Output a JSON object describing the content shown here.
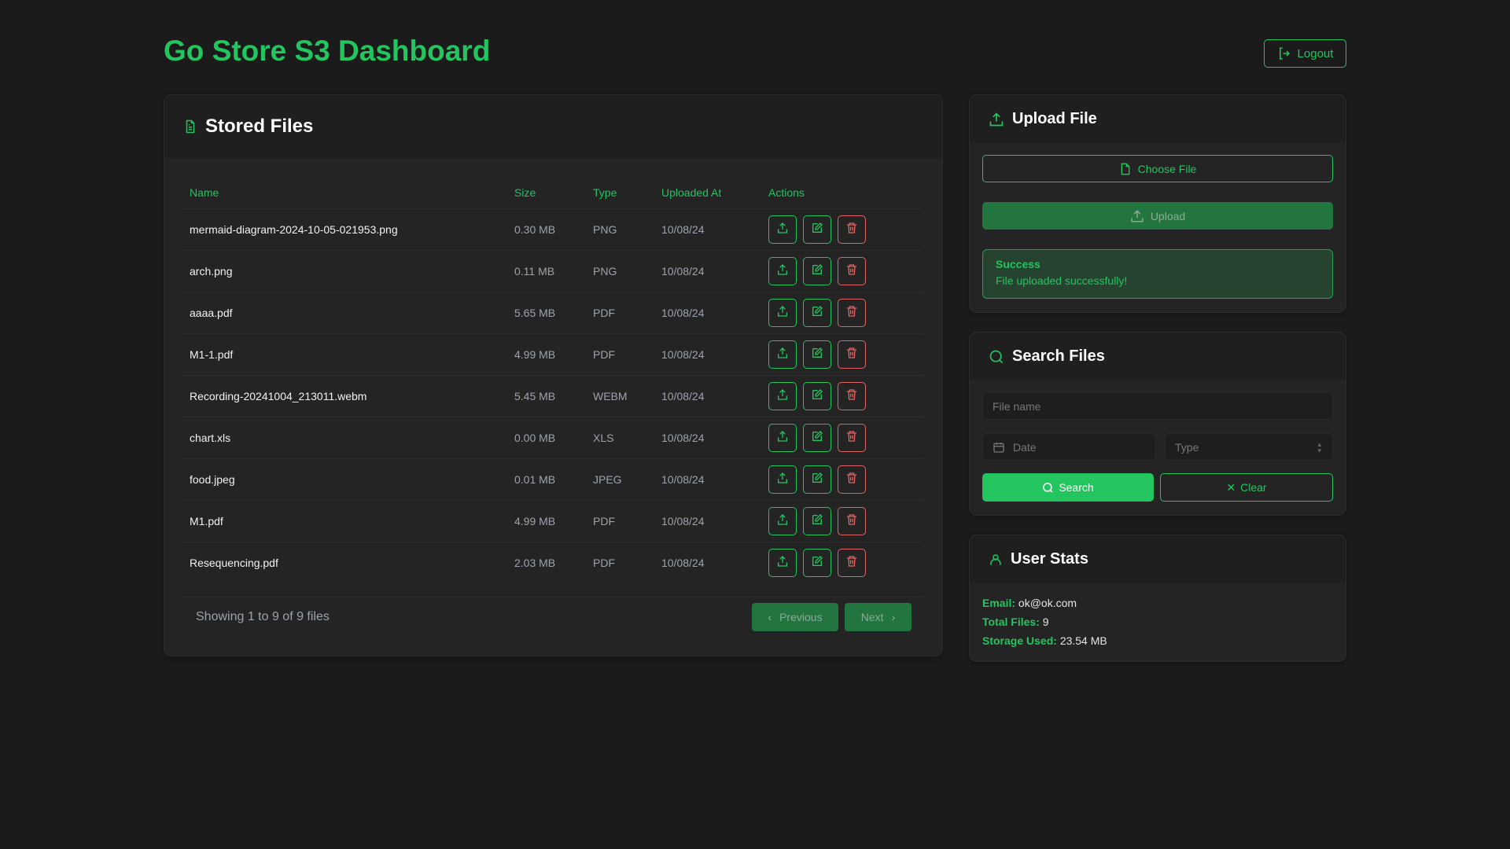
{
  "header": {
    "title": "Go Store S3 Dashboard",
    "logout": "Logout"
  },
  "files": {
    "title": "Stored Files",
    "columns": [
      "Name",
      "Size",
      "Type",
      "Uploaded At",
      "Actions"
    ],
    "rows": [
      {
        "name": "mermaid-diagram-2024-10-05-021953.png",
        "size": "0.30 MB",
        "type": "PNG",
        "uploaded": "10/08/24"
      },
      {
        "name": "arch.png",
        "size": "0.11 MB",
        "type": "PNG",
        "uploaded": "10/08/24"
      },
      {
        "name": "aaaa.pdf",
        "size": "5.65 MB",
        "type": "PDF",
        "uploaded": "10/08/24"
      },
      {
        "name": "M1-1.pdf",
        "size": "4.99 MB",
        "type": "PDF",
        "uploaded": "10/08/24"
      },
      {
        "name": "Recording-20241004_213011.webm",
        "size": "5.45 MB",
        "type": "WEBM",
        "uploaded": "10/08/24"
      },
      {
        "name": "chart.xls",
        "size": "0.00 MB",
        "type": "XLS",
        "uploaded": "10/08/24"
      },
      {
        "name": "food.jpeg",
        "size": "0.01 MB",
        "type": "JPEG",
        "uploaded": "10/08/24"
      },
      {
        "name": "M1.pdf",
        "size": "4.99 MB",
        "type": "PDF",
        "uploaded": "10/08/24"
      },
      {
        "name": "Resequencing.pdf",
        "size": "2.03 MB",
        "type": "PDF",
        "uploaded": "10/08/24"
      }
    ],
    "showing": "Showing 1 to 9 of 9 files",
    "previous": "Previous",
    "next": "Next"
  },
  "upload": {
    "title": "Upload File",
    "choose": "Choose File",
    "upload": "Upload",
    "alert_title": "Success",
    "alert_msg": "File uploaded successfully!"
  },
  "search": {
    "title": "Search Files",
    "name_placeholder": "File name",
    "date_placeholder": "Date",
    "type_placeholder": "Type",
    "search": "Search",
    "clear": "Clear"
  },
  "stats": {
    "title": "User Stats",
    "email_label": "Email:",
    "email": "ok@ok.com",
    "files_label": "Total Files:",
    "files": "9",
    "storage_label": "Storage Used:",
    "storage": "23.54 MB"
  },
  "colors": {
    "accent": "#22c55e",
    "danger": "#e06666",
    "bg": "#1b1b1b"
  }
}
